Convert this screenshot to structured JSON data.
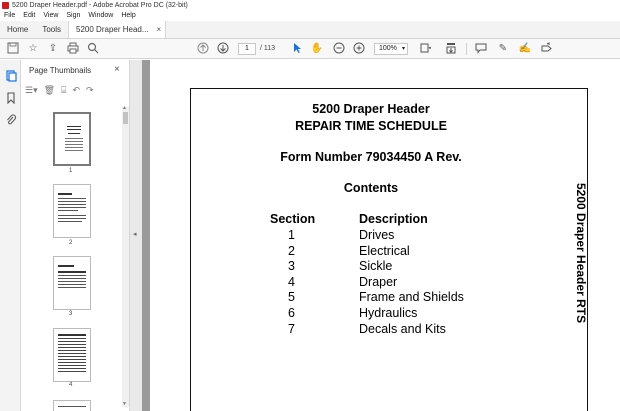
{
  "window": {
    "title": "5200 Draper Header.pdf - Adobe Acrobat Pro DC (32-bit)"
  },
  "menu": [
    "File",
    "Edit",
    "View",
    "Sign",
    "Window",
    "Help"
  ],
  "tabs": {
    "home": "Home",
    "tools": "Tools",
    "document": "5200 Draper Head...",
    "close": "×"
  },
  "toolbar": {
    "current_page": "1",
    "total_pages": "/ 113",
    "zoom": "100%"
  },
  "thumbnails_panel": {
    "title": "Page Thumbnails",
    "close": "×",
    "pages": [
      "1",
      "2",
      "3",
      "4"
    ]
  },
  "document": {
    "title_line1": "5200 Draper Header",
    "title_line2": "REPAIR TIME SCHEDULE",
    "form_number": "Form Number 79034450 A Rev.",
    "contents_heading": "Contents",
    "section_header": "Section",
    "description_header": "Description",
    "contents": [
      {
        "section": "1",
        "description": "Drives"
      },
      {
        "section": "2",
        "description": "Electrical"
      },
      {
        "section": "3",
        "description": "Sickle"
      },
      {
        "section": "4",
        "description": "Draper"
      },
      {
        "section": "5",
        "description": "Frame and Shields"
      },
      {
        "section": "6",
        "description": "Hydraulics"
      },
      {
        "section": "7",
        "description": "Decals and Kits"
      }
    ],
    "side_title": "5200 Draper Header RTS"
  },
  "colors": {
    "accent": "#1473e6",
    "app_icon": "#d0191f",
    "doc_background": "#9a9a9a"
  }
}
